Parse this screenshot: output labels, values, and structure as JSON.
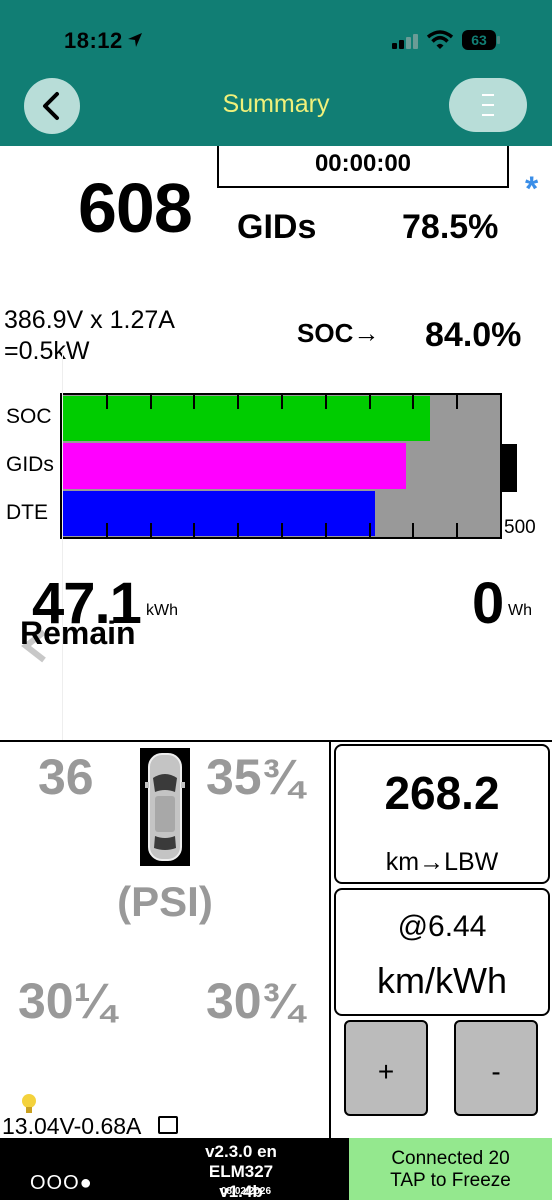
{
  "status_bar": {
    "time": "18:12",
    "battery_level": "63"
  },
  "header": {
    "title": "Summary"
  },
  "timer": "00:00:00",
  "gids": {
    "value": "608",
    "label": "GIDs",
    "percent": "78.5%"
  },
  "power": {
    "line1": "386.9V x 1.27A",
    "line2": "=0.5kW"
  },
  "soc": {
    "label": "SOC→",
    "value": "84.0%"
  },
  "bar_chart": {
    "max_label": "500",
    "bars": [
      {
        "label": "SOC",
        "fraction": 0.84,
        "color": "#00cc00"
      },
      {
        "label": "GIDs",
        "fraction": 0.785,
        "color": "#ff00ff"
      },
      {
        "label": "DTE",
        "fraction": 0.714,
        "color": "#0000ff"
      }
    ],
    "tick_count": 10
  },
  "energy": {
    "remain_value": "47.1",
    "remain_unit": "kWh",
    "remain_label": "Remain",
    "used_value": "0",
    "used_unit": "Wh"
  },
  "tires": {
    "front_left": "36",
    "front_right": "35¾",
    "rear_left": "30¼",
    "rear_right": "30¾",
    "unit": "(PSI)"
  },
  "aux_battery": "13.04V-0.68A",
  "distance": {
    "value": "268.2",
    "label": "km→LBW"
  },
  "efficiency": {
    "value": "@6.44",
    "unit": "km/kWh"
  },
  "buttons": {
    "plus": "+",
    "minus": "-"
  },
  "footer": {
    "dots": "OOO●",
    "version": "v2.3.0 en",
    "adapter": "ELM327 v1.4b",
    "date": "08/02/2026",
    "connection": "Connected 20",
    "action": "TAP to Freeze"
  },
  "colors": {
    "header_bg": "#117e74",
    "title": "#f0f07a",
    "accent": "#3a8ee8",
    "footer_green": "#94e88e"
  }
}
